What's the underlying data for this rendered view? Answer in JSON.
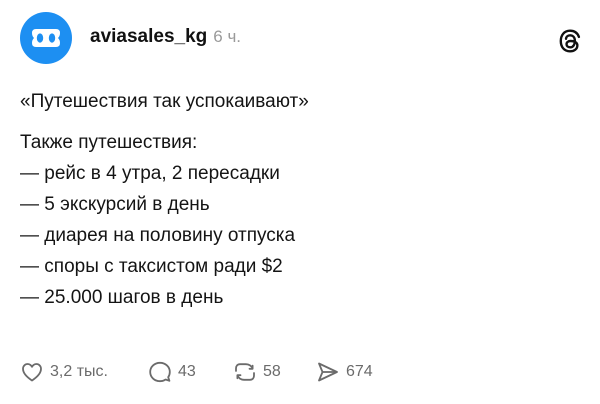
{
  "post": {
    "author": {
      "username": "aviasales_kg",
      "time": "6 ч.",
      "avatar_icon": "aviasales-logo-icon",
      "avatar_color": "#1d8ff2"
    },
    "platform_icon": "threads-icon",
    "quote": "«Путешествия так успокаивают»",
    "body": [
      "Также путешествия:",
      "— рейс в 4 утра, 2 пересадки",
      "— 5 экскурсий в день",
      "— диарея на половину отпуска",
      "— споры с таксистом ради $2",
      "— 25.000 шагов в день"
    ],
    "actions": {
      "likes": "3,2 тыс.",
      "comments": "43",
      "reposts": "58",
      "shares": "674"
    }
  }
}
